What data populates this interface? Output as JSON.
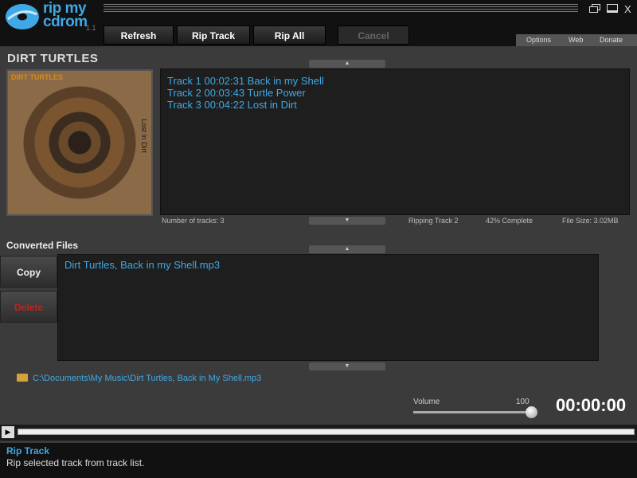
{
  "app": {
    "logo_line1": "rip my",
    "logo_line2": "cdrom",
    "version": "1.1",
    "close": "X"
  },
  "toolbar": {
    "refresh": "Refresh",
    "rip_track": "Rip Track",
    "rip_all": "Rip All",
    "cancel": "Cancel"
  },
  "links": {
    "options": "Options",
    "web": "Web",
    "donate": "Donate"
  },
  "album": {
    "title": "DIRT TURTLES",
    "art_band": "DIRT TURTLES",
    "art_side_text": "Lost in Dirt"
  },
  "tracks": [
    "Track 1 00:02:31 Back in my Shell",
    "Track 2 00:03:43 Turtle Power",
    "Track 3 00:04:22 Lost in Dirt"
  ],
  "status": {
    "number_of_tracks": "Number of tracks: 3",
    "ripping": "Ripping Track 2",
    "complete": "42% Complete",
    "file_size": "File Size: 3.02MB"
  },
  "converted": {
    "title": "Converted Files",
    "copy": "Copy",
    "delete": "Delete",
    "files": [
      "Dirt Turtles, Back in my Shell.mp3"
    ],
    "path": "C:\\Documents\\My Music\\Dirt Turtles, Back in My Shell.mp3"
  },
  "volume": {
    "label": "Volume",
    "value": "100",
    "level": 1.0
  },
  "time": "00:00:00",
  "info": {
    "title": "Rip Track",
    "description": "Rip selected track from track list."
  },
  "colors": {
    "accent": "#3fa9e6",
    "danger": "#c0231c"
  }
}
